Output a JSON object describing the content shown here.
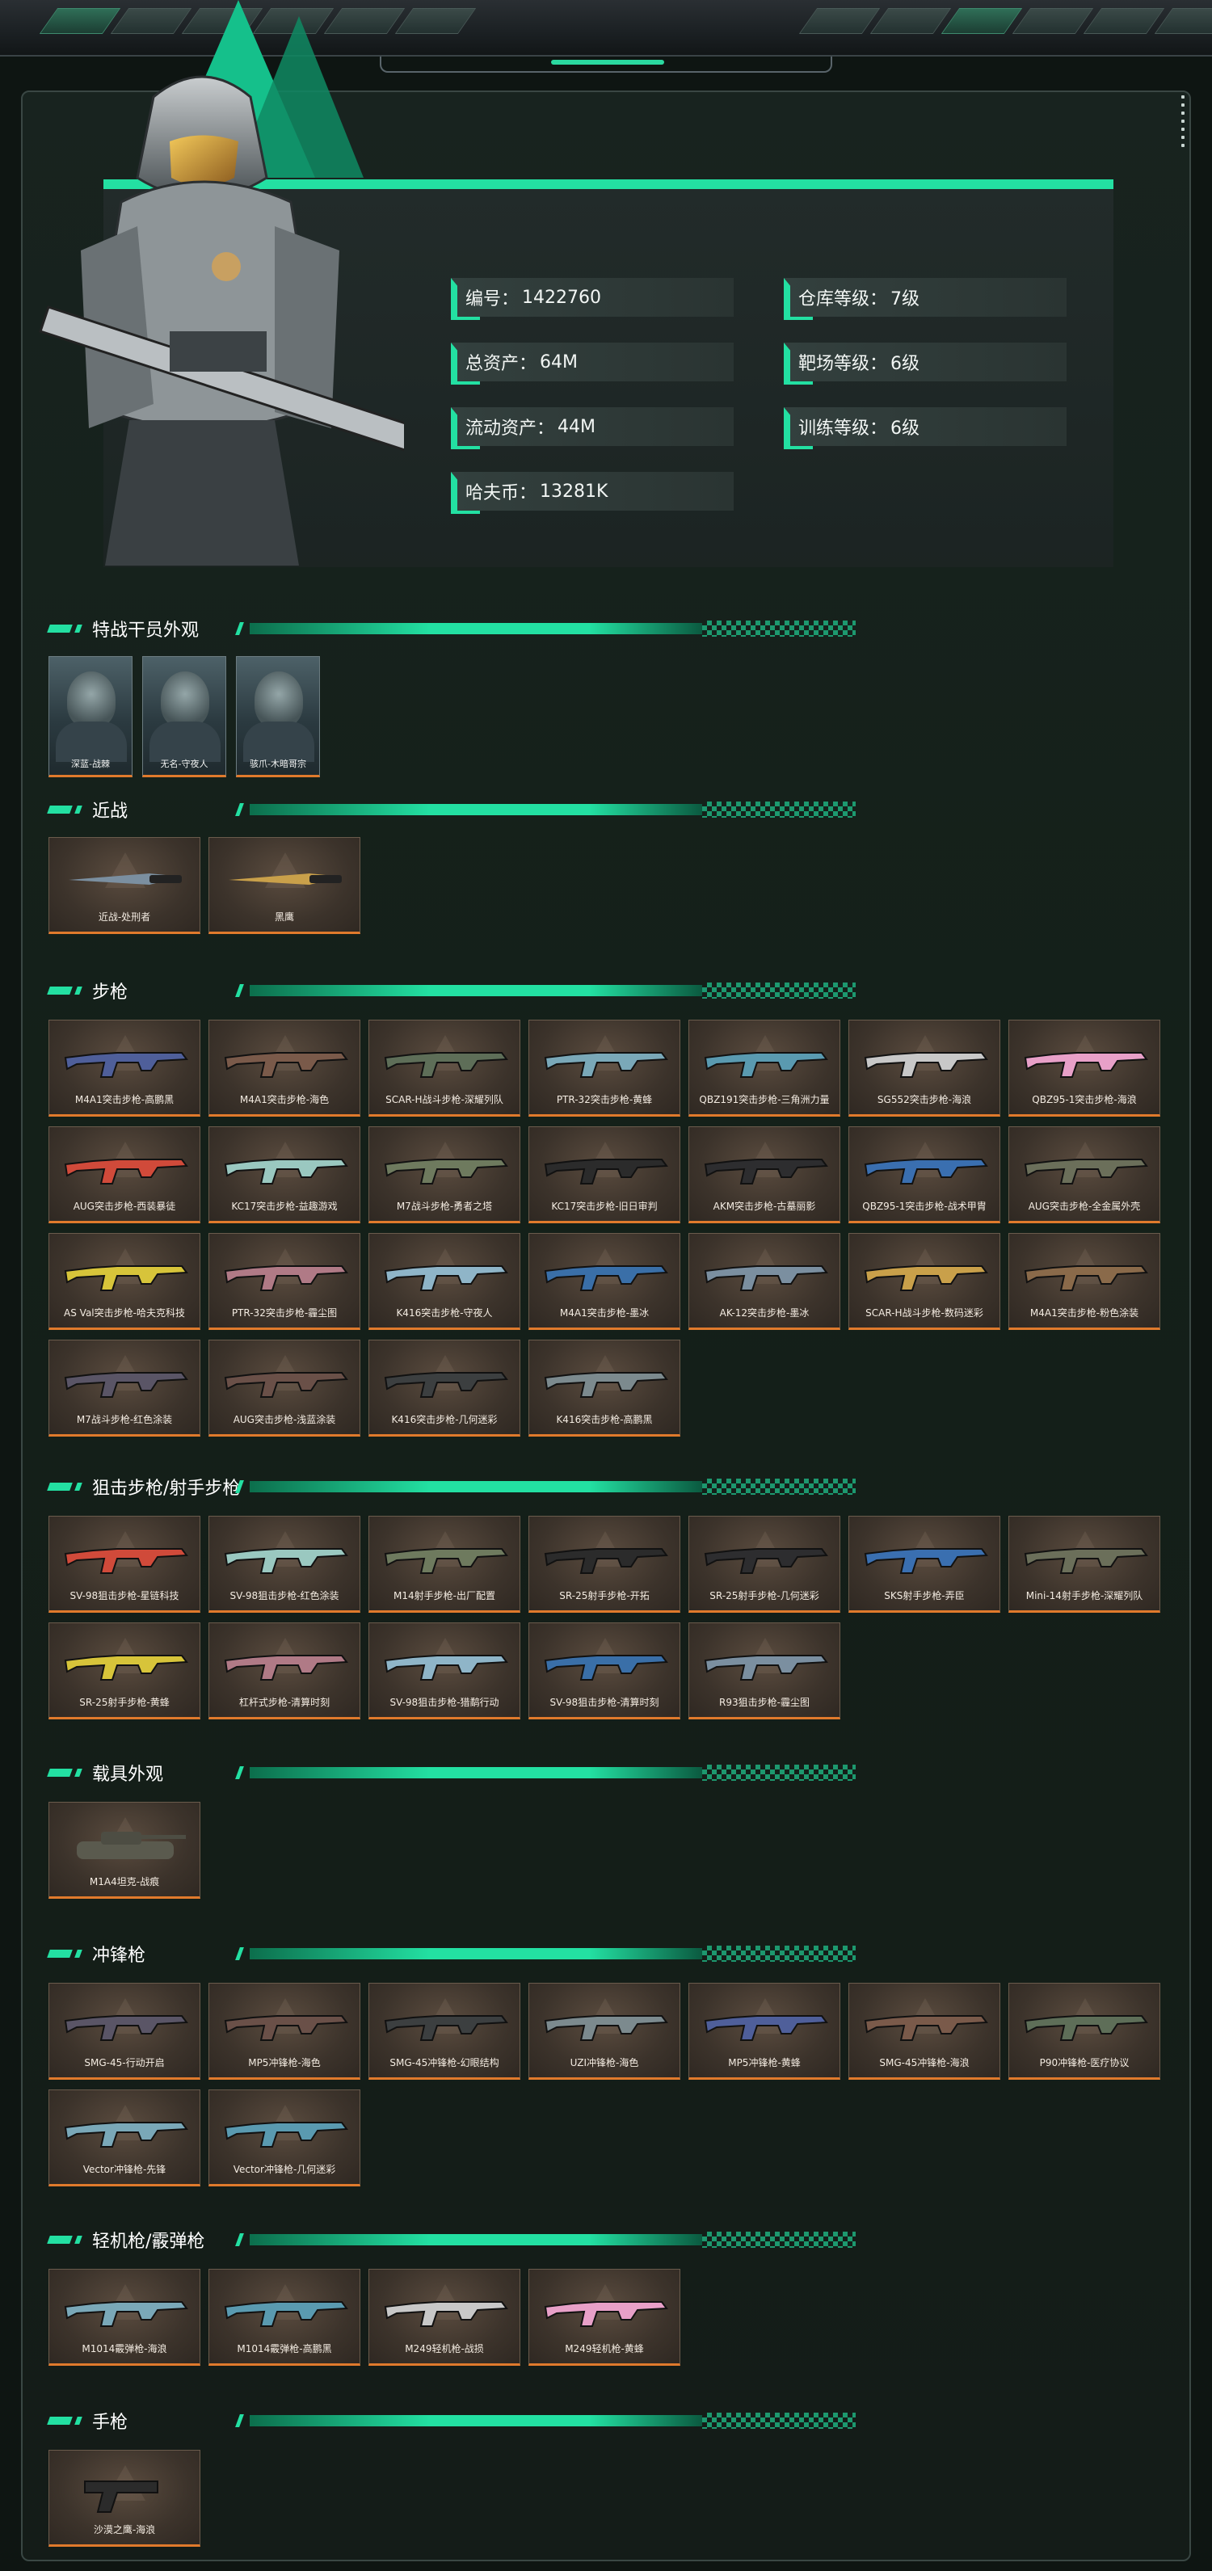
{
  "colors": {
    "accent": "#23e0a2",
    "card_border": "#e07a2c",
    "background": "#0e1512"
  },
  "stats": [
    {
      "label": "编号：",
      "value": "1422760"
    },
    {
      "label": "仓库等级：",
      "value": "7级"
    },
    {
      "label": "总资产：",
      "value": "64M"
    },
    {
      "label": "靶场等级：",
      "value": "6级"
    },
    {
      "label": "流动资产：",
      "value": "44M"
    },
    {
      "label": "训练等级：",
      "value": "6级"
    },
    {
      "label": "哈夫币：",
      "value": "13281K"
    }
  ],
  "sections": [
    {
      "title": "特战干员外观",
      "type": "operator",
      "items": [
        "深蓝-战棘",
        "无名-守夜人",
        "骇爪-木暗哥宗"
      ]
    },
    {
      "title": "近战",
      "items": [
        "近战-处刑者",
        "黑鹰"
      ]
    },
    {
      "title": "步枪",
      "items": [
        "M4A1突击步枪-高鹏黑",
        "M4A1突击步枪-海色",
        "SCAR-H战斗步枪-深耀列队",
        "PTR-32突击步枪-黄蜂",
        "QBZ191突击步枪-三角洲力量",
        "SG552突击步枪-海浪",
        "QBZ95-1突击步枪-海浪",
        "AUG突击步枪-西装暴徒",
        "KC17突击步枪-益趣游戏",
        "M7战斗步枪-勇者之塔",
        "KC17突击步枪-旧日审判",
        "AKM突击步枪-古墓丽影",
        "QBZ95-1突击步枪-战术甲胄",
        "AUG突击步枪-全金属外壳",
        "AS Val突击步枪-哈夫克科技",
        "PTR-32突击步枪-霾尘图",
        "K416突击步枪-守夜人",
        "M4A1突击步枪-墨冰",
        "AK-12突击步枪-墨冰",
        "SCAR-H战斗步枪-数码迷彩",
        "M4A1突击步枪-粉色涂装",
        "M7战斗步枪-红色涂装",
        "AUG突击步枪-浅蓝涂装",
        "K416突击步枪-几何迷彩",
        "K416突击步枪-高鹏黑"
      ]
    },
    {
      "title": "狙击步枪/射手步枪",
      "items": [
        "SV-98狙击步枪-星链科技",
        "SV-98狙击步枪-红色涂装",
        "M14射手步枪-出厂配置",
        "SR-25射手步枪-开拓",
        "SR-25射手步枪-几何迷彩",
        "SKS射手步枪-弄臣",
        "Mini-14射手步枪-深耀列队",
        "SR-25射手步枪-黄蜂",
        "杠杆式步枪-清算时刻",
        "SV-98狙击步枪-猎鹬行动",
        "SV-98狙击步枪-清算时刻",
        "R93狙击步枪-霾尘图"
      ]
    },
    {
      "title": "载具外观",
      "items": [
        "M1A4坦克-战痕"
      ]
    },
    {
      "title": "冲锋枪",
      "items": [
        "SMG-45-行动开启",
        "MP5冲锋枪-海色",
        "SMG-45冲锋枪-幻眼结构",
        "UZI冲锋枪-海色",
        "MP5冲锋枪-黄蜂",
        "SMG-45冲锋枪-海浪",
        "P90冲锋枪-医疗协议",
        "Vector冲锋枪-先锋",
        "Vector冲锋枪-几何迷彩"
      ]
    },
    {
      "title": "轻机枪/霰弹枪",
      "items": [
        "M1014霰弹枪-海浪",
        "M1014霰弹枪-高鹏黑",
        "M249轻机枪-战损",
        "M249轻机枪-黄蜂"
      ]
    },
    {
      "title": "手枪",
      "items": [
        "沙漠之鹰-海浪"
      ]
    }
  ]
}
